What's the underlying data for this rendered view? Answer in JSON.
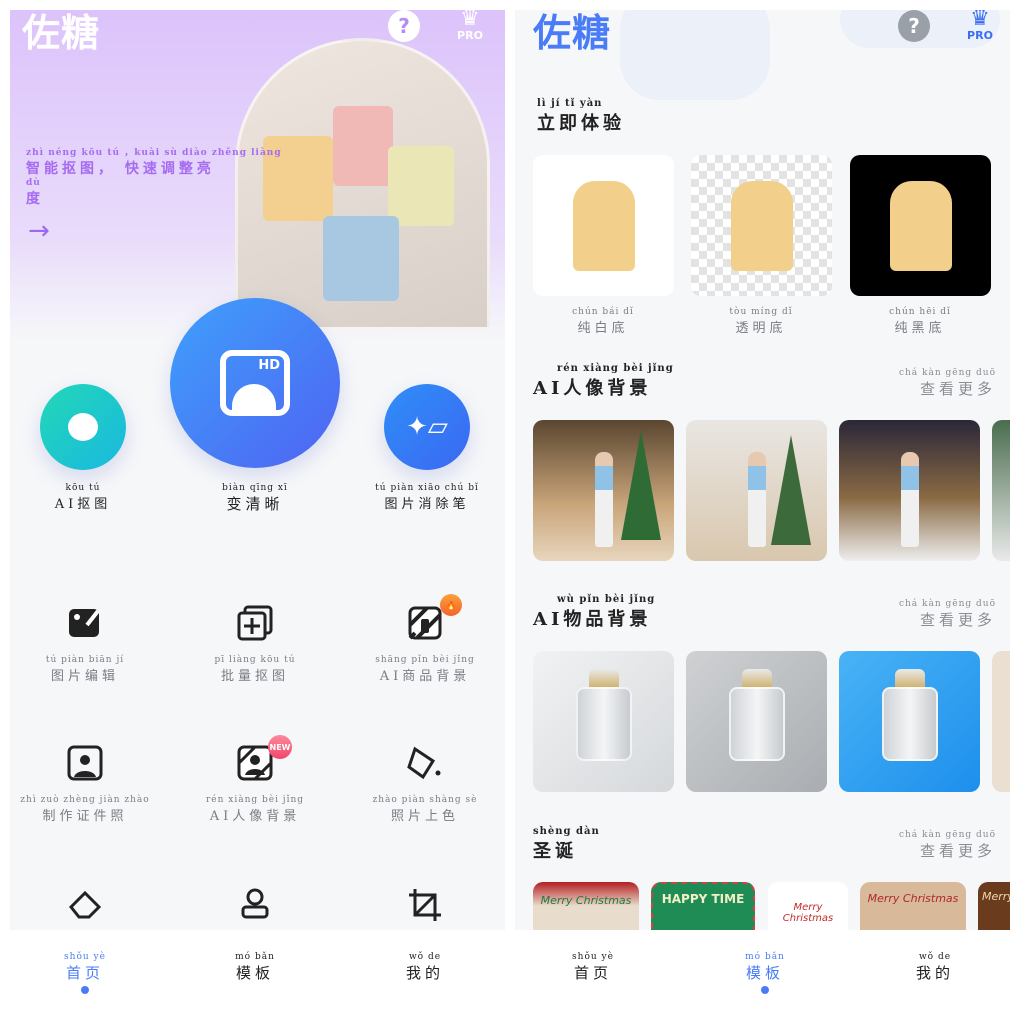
{
  "colors": {
    "accent_blue": "#4a7cf7",
    "purple": "#a66cf0",
    "hot_badge": "#f57b2f",
    "new_badge": "#f0577a"
  },
  "left": {
    "logo": "佐糖",
    "help_label": "?",
    "pro_label": "PRO",
    "slogan": {
      "line1": {
        "pinyin": "zhì néng kōu tú ，kuài sù diào zhěng liàng",
        "text": "智能抠图， 快速调整亮"
      },
      "line2": {
        "pinyin": "dù",
        "text": "度"
      }
    },
    "hero_icon": "arrow-right-icon",
    "main_tools": [
      {
        "pinyin": "kōu tú",
        "text": "AI抠图",
        "icon": "chat-cutout-icon"
      },
      {
        "pinyin": "biàn qīng xī",
        "text": "变清晰",
        "icon": "hd-image-icon",
        "icon_text": "HD"
      },
      {
        "pinyin": "tú piàn xiāo chú bǐ",
        "text": "图片消除笔",
        "icon": "eraser-icon"
      }
    ],
    "grid": [
      {
        "pinyin": "tú piàn biān jí",
        "text": "图片编辑",
        "icon": "image-edit-icon"
      },
      {
        "pinyin": "pī liàng kōu tú",
        "text": "批量抠图",
        "icon": "batch-add-icon"
      },
      {
        "pinyin": "shāng pǐn bèi jǐng",
        "text": "AI商品背景",
        "icon": "product-bg-icon",
        "badge": "fire"
      },
      {
        "pinyin": "zhì zuò zhèng jiàn zhào",
        "text": "制作证件照",
        "icon": "id-photo-icon"
      },
      {
        "pinyin": "rén xiàng bèi jǐng",
        "text": "AI人像背景",
        "icon": "portrait-bg-icon",
        "badge": "NEW"
      },
      {
        "pinyin": "zhào piàn shàng sè",
        "text": "照片上色",
        "icon": "paint-bucket-icon"
      },
      {
        "icon": "eraser-outline-icon"
      },
      {
        "icon": "stamp-icon"
      },
      {
        "icon": "crop-icon"
      }
    ]
  },
  "right": {
    "logo": "佐糖",
    "help_label": "?",
    "pro_label": "PRO",
    "try_now": {
      "pinyin": "lì jí tǐ yàn",
      "text": "立即体验",
      "cards": [
        {
          "pinyin": "chún bái dǐ",
          "text": "纯白底"
        },
        {
          "pinyin": "tòu míng dǐ",
          "text": "透明底"
        },
        {
          "pinyin": "chún hēi dǐ",
          "text": "纯黑底"
        }
      ]
    },
    "more": {
      "pinyin": "chá kàn gēng duō",
      "text": "查看更多"
    },
    "sections": [
      {
        "pinyin": "rén xiàng bèi jǐng",
        "text": "AI人像背景"
      },
      {
        "pinyin": "wù pǐn bèi jǐng",
        "text": "AI物品背景"
      },
      {
        "pinyin": "shèng dàn",
        "text": "圣诞",
        "cards": [
          "Merry Christmas",
          "HAPPY TIME",
          "Merry Christmas",
          "Merry Christmas",
          "Merry"
        ]
      }
    ]
  },
  "nav": [
    {
      "pinyin": "shǒu yè",
      "text": "首页"
    },
    {
      "pinyin": "mó bǎn",
      "text": "模板"
    },
    {
      "pinyin": "wǒ de",
      "text": "我的"
    }
  ],
  "nav_active": {
    "left": "首页",
    "right": "模板"
  }
}
